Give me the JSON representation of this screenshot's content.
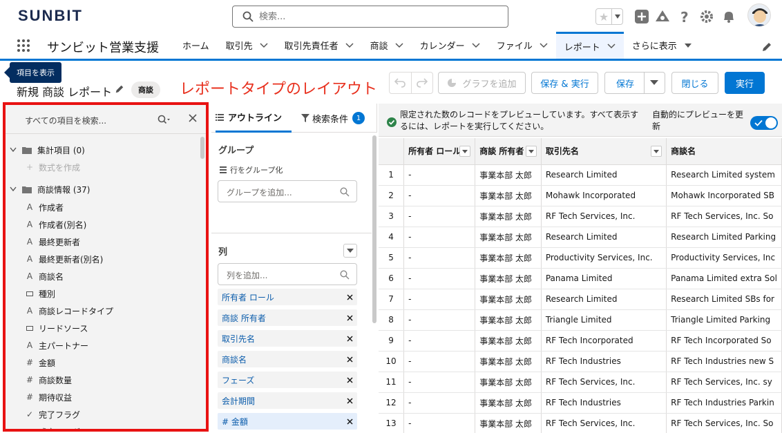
{
  "header": {
    "logo": "SUNBIT",
    "search_placeholder": "検索..."
  },
  "nav": {
    "app_name": "サンビット営業支援",
    "items": [
      {
        "label": "ホーム",
        "chevron": false
      },
      {
        "label": "取引先",
        "chevron": true
      },
      {
        "label": "取引先責任者",
        "chevron": true
      },
      {
        "label": "商談",
        "chevron": true
      },
      {
        "label": "カレンダー",
        "chevron": true
      },
      {
        "label": "ファイル",
        "chevron": true
      },
      {
        "label": "レポート",
        "chevron": true,
        "active": true
      },
      {
        "label": "さらに表示",
        "chevron": true
      }
    ]
  },
  "tooltip": "項目を表示",
  "report": {
    "title": "新規 商談 レポート",
    "type_badge": "商談",
    "annotation": "レポートタイプのレイアウト",
    "buttons": {
      "add_chart": "グラフを追加",
      "save_run": "保存 & 実行",
      "save": "保存",
      "close": "閉じる",
      "run": "実行"
    }
  },
  "fields_panel": {
    "search_placeholder": "すべての項目を検索...",
    "groups": [
      {
        "label": "集計項目 (0)",
        "children": [
          {
            "label": "数式を作成",
            "icon": "plus",
            "disabled": true
          }
        ]
      },
      {
        "label": "商談情報 (37)",
        "children": [
          {
            "label": "作成者",
            "icon": "A"
          },
          {
            "label": "作成者(別名)",
            "icon": "A"
          },
          {
            "label": "最終更新者",
            "icon": "A"
          },
          {
            "label": "最終更新者(別名)",
            "icon": "A"
          },
          {
            "label": "商談名",
            "icon": "A"
          },
          {
            "label": "種別",
            "icon": "picklist"
          },
          {
            "label": "商談レコードタイプ",
            "icon": "A"
          },
          {
            "label": "リードソース",
            "icon": "picklist"
          },
          {
            "label": "主パートナー",
            "icon": "A"
          },
          {
            "label": "金額",
            "icon": "#"
          },
          {
            "label": "商談数量",
            "icon": "#"
          },
          {
            "label": "期待収益",
            "icon": "#"
          },
          {
            "label": "完了フラグ",
            "icon": "check"
          },
          {
            "label": "成立フラグ",
            "icon": "check"
          }
        ]
      }
    ]
  },
  "outline": {
    "tab_outline": "アウトライン",
    "tab_filters": "検索条件",
    "filter_count": "1",
    "groups_title": "グループ",
    "group_rows_label": "行をグループ化",
    "group_placeholder": "グループを追加...",
    "columns_title": "列",
    "column_placeholder": "列を追加...",
    "columns": [
      {
        "label": "所有者 ロール"
      },
      {
        "label": "商談 所有者"
      },
      {
        "label": "取引先名"
      },
      {
        "label": "商談名"
      },
      {
        "label": "フェーズ"
      },
      {
        "label": "会計期間"
      },
      {
        "label": "# 金額",
        "highlight": true
      }
    ]
  },
  "preview": {
    "message": "限定された数のレコードをプレビューしています。すべて表示するには、レポートを実行してください。",
    "auto_preview_label": "自動的にプレビューを更新",
    "auto_preview_on": true,
    "headers": [
      "",
      "所有者 ロール",
      "商談 所有者",
      "取引先名",
      "商談名"
    ],
    "rows": [
      [
        "1",
        "-",
        "事業本部 太郎",
        "Research Limited",
        "Research Limited system"
      ],
      [
        "2",
        "-",
        "事業本部 太郎",
        "Mohawk Incorporated",
        "Mohawk Incorporated SB"
      ],
      [
        "3",
        "-",
        "事業本部 太郎",
        "RF Tech Services, Inc.",
        "RF Tech Services, Inc. So"
      ],
      [
        "4",
        "-",
        "事業本部 太郎",
        "Research Limited",
        "Research Limited Parking"
      ],
      [
        "5",
        "-",
        "事業本部 太郎",
        "Productivity Services, Inc.",
        "Productivity Services, Inc"
      ],
      [
        "6",
        "-",
        "事業本部 太郎",
        "Panama Limited",
        "Panama Limited extra Sol"
      ],
      [
        "7",
        "-",
        "事業本部 太郎",
        "Research Limited",
        "Research Limited SBs for"
      ],
      [
        "8",
        "-",
        "事業本部 太郎",
        "Triangle Limited",
        "Triangle Limited Parking"
      ],
      [
        "9",
        "-",
        "事業本部 太郎",
        "RF Tech Incorporated",
        "RF Tech Incorporated So"
      ],
      [
        "10",
        "-",
        "事業本部 太郎",
        "RF Tech Industries",
        "RF Tech Industries new S"
      ],
      [
        "11",
        "-",
        "事業本部 太郎",
        "RF Tech Services, Inc.",
        "RF Tech Services, Inc. sy"
      ],
      [
        "12",
        "-",
        "事業本部 太郎",
        "RF Tech Industries",
        "RF Tech Industries Parkin"
      ],
      [
        "13",
        "-",
        "事業本部 太郎",
        "RF Tech Services, Inc.",
        "RF Tech Services, Inc. So"
      ]
    ]
  },
  "colors": {
    "brand": "#0176d3",
    "annotation": "#e8301e",
    "highlight_border": "#e81212"
  }
}
